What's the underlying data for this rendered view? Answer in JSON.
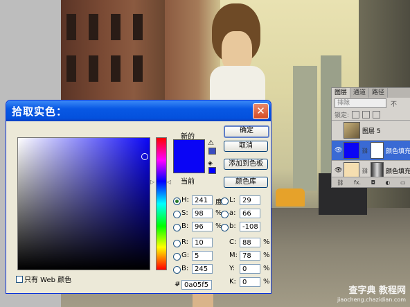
{
  "dialog": {
    "title": "拾取实色：",
    "close_glyph": "✕",
    "new_label": "新的",
    "current_label": "当前",
    "gamut_warning_glyph": "⚠",
    "web_safe_glyph": "◈",
    "buttons": {
      "ok": "确定",
      "cancel": "取消",
      "add_to_swatches": "添加到色板",
      "color_libraries": "颜色库"
    },
    "hue_left_arrow": "▷",
    "hue_right_arrow": "◁",
    "fields": {
      "H": {
        "label": "H:",
        "value": "241",
        "unit": "度"
      },
      "S": {
        "label": "S:",
        "value": "98",
        "unit": "%"
      },
      "B": {
        "label": "B:",
        "value": "96",
        "unit": "%"
      },
      "R": {
        "label": "R:",
        "value": "10",
        "unit": ""
      },
      "G": {
        "label": "G:",
        "value": "5",
        "unit": ""
      },
      "Bl": {
        "label": "B:",
        "value": "245",
        "unit": ""
      },
      "L": {
        "label": "L:",
        "value": "29",
        "unit": ""
      },
      "a": {
        "label": "a:",
        "value": "66",
        "unit": ""
      },
      "b": {
        "label": "b:",
        "value": "-108",
        "unit": ""
      },
      "C": {
        "label": "C:",
        "value": "88",
        "unit": "%"
      },
      "M": {
        "label": "M:",
        "value": "78",
        "unit": "%"
      },
      "Y": {
        "label": "Y:",
        "value": "0",
        "unit": "%"
      },
      "K": {
        "label": "K:",
        "value": "0",
        "unit": "%"
      },
      "hex": {
        "label": "#",
        "value": "0a05f5"
      }
    },
    "web_only_label": "只有 Web 颜色",
    "selected_color": "#0a05f5"
  },
  "layers_panel": {
    "tabs": [
      "图层",
      "通道",
      "路径"
    ],
    "blend_mode": "排除",
    "blend_extra": "不",
    "lock_label": "锁定:",
    "layers": [
      {
        "name": "图层 5",
        "eye": ""
      },
      {
        "name": "颜色填充",
        "eye": "👁"
      },
      {
        "name": "颜色填充",
        "eye": "👁"
      }
    ],
    "footer_icons": [
      "⛓",
      "fx.",
      "◘",
      "◐",
      "▭"
    ]
  },
  "watermark": {
    "line1": "查字典 教程网",
    "line2": "jiaocheng.chazidian.com"
  }
}
